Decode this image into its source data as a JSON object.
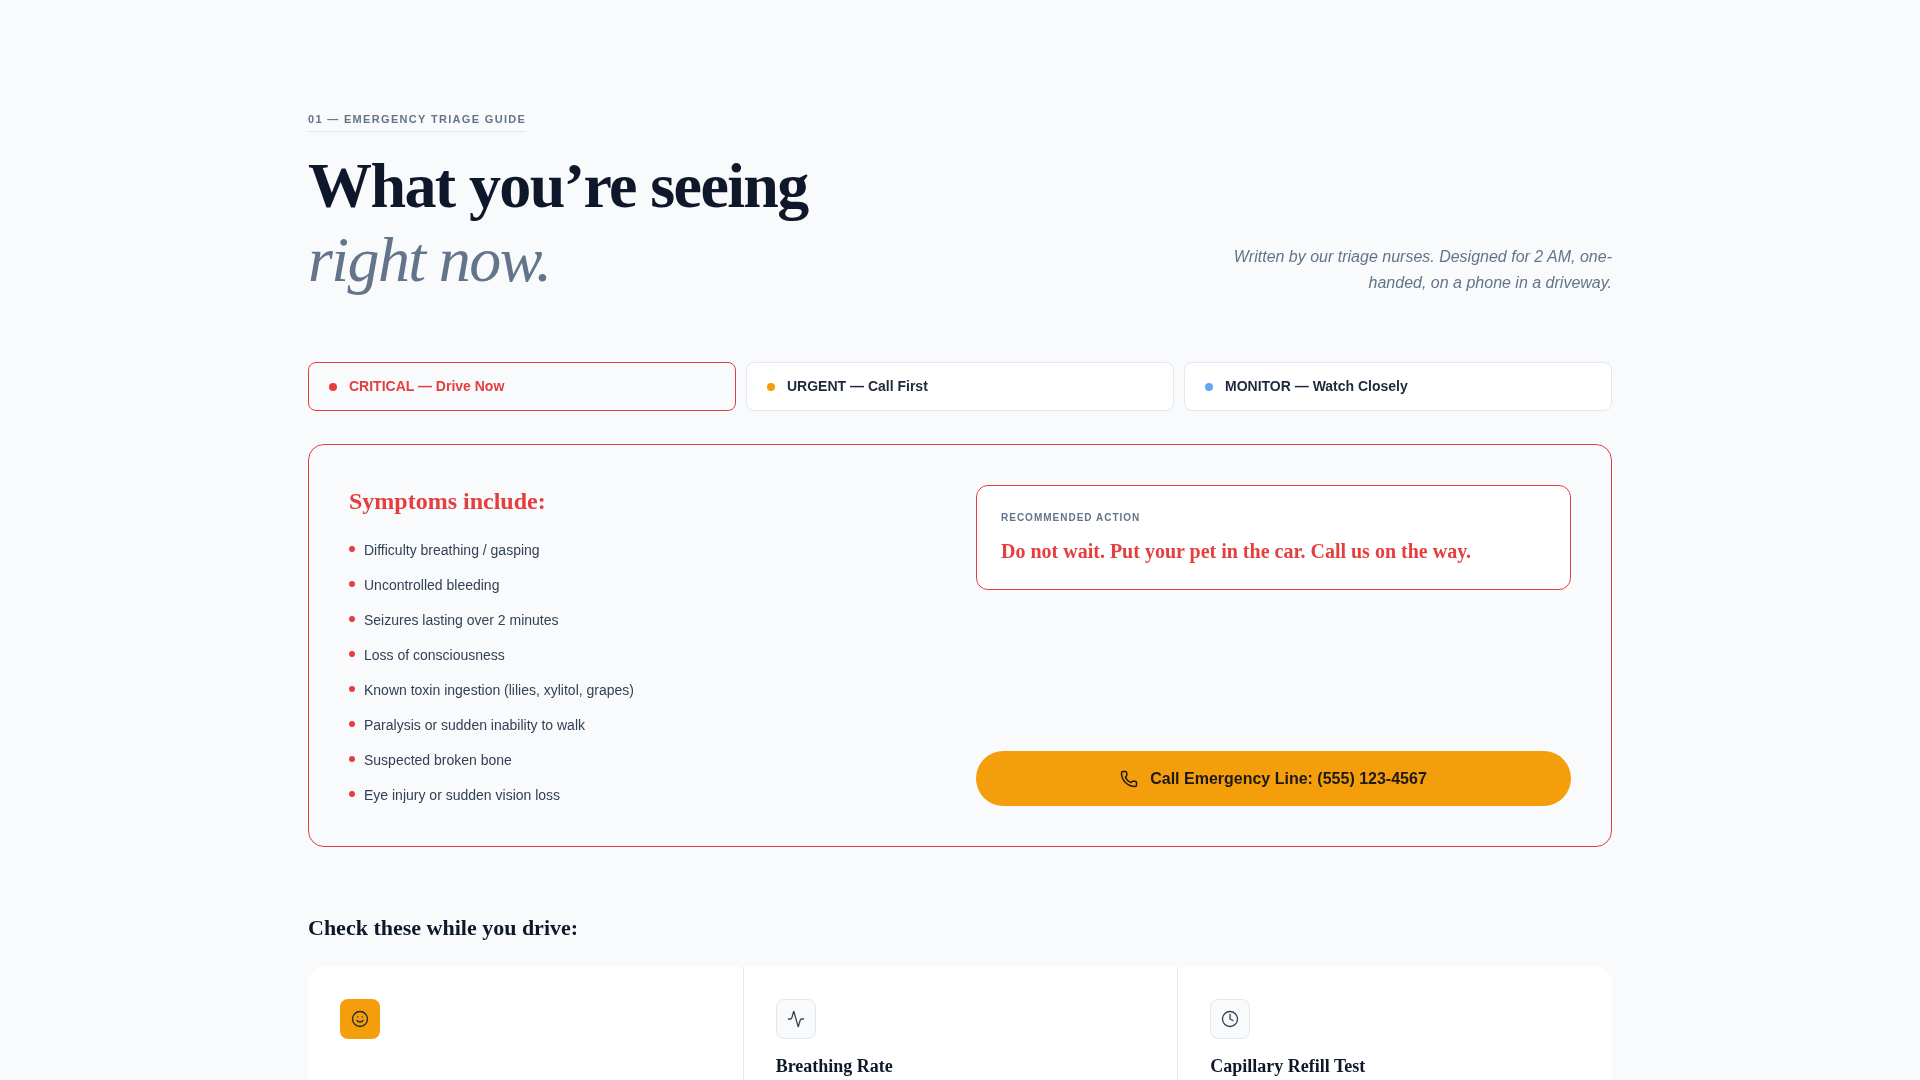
{
  "header": {
    "eyebrow": "01 — EMERGENCY TRIAGE GUIDE",
    "title": "What you’re seeing",
    "title_accent": "right now.",
    "subtitle": "Written by our triage nurses. Designed for 2 AM, one-handed, on a phone in a driveway."
  },
  "tabs": [
    {
      "label": "CRITICAL — Drive Now",
      "color": "#e53e3e",
      "selected": true
    },
    {
      "label": "URGENT — Call First",
      "color": "#f59e0b",
      "selected": false
    },
    {
      "label": "MONITOR — Watch Closely",
      "color": "#60a5fa",
      "selected": false
    }
  ],
  "panel": {
    "heading": "Symptoms include:",
    "symptoms": [
      "Difficulty breathing / gasping",
      "Uncontrolled bleeding",
      "Seizures lasting over 2 minutes",
      "Loss of consciousness",
      "Known toxin ingestion (lilies, xylitol, grapes)",
      "Paralysis or sudden inability to walk",
      "Suspected broken bone",
      "Eye injury or sudden vision loss"
    ],
    "recommendation": {
      "label": "RECOMMENDED ACTION",
      "text": "Do not wait. Put your pet in the car. Call us on the way."
    },
    "call_button": "Call Emergency Line: (555) 123-4567"
  },
  "checks": {
    "heading": "Check these while you drive:",
    "cards": [
      {
        "selected": true
      },
      {
        "title": "Breathing Rate",
        "selected": false
      },
      {
        "title": "Capillary Refill Test",
        "selected": false
      }
    ]
  }
}
